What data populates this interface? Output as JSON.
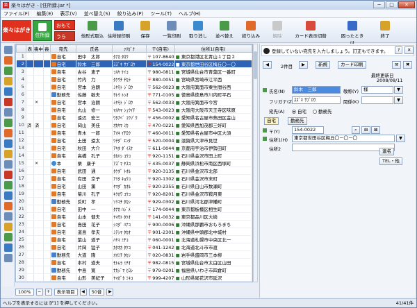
{
  "window": {
    "title": "楽々はがき - [住所録.jar *]",
    "app_icon": "楽",
    "min": "─",
    "max": "□",
    "close": "✕"
  },
  "menubar": [
    "ファイル(F)",
    "編集(E)",
    "表示(V)",
    "並べ替え(S)",
    "絞り込み(P)",
    "ツール(T)",
    "ヘルプ(H)"
  ],
  "toolbar": {
    "brand": "楽々はがき",
    "tab_address": "住所録",
    "tab_omote": "おもて",
    "tab_ura": "うら",
    "buttons": [
      {
        "label": "他形式取込",
        "icon": "import-icon",
        "color": "#4a9a4a",
        "disabled": false
      },
      {
        "label": "住所録印刷",
        "icon": "print-icon",
        "color": "#3a7ac2",
        "disabled": false
      },
      {
        "label": "保存",
        "icon": "save-icon",
        "color": "#d6a22a",
        "disabled": false
      },
      {
        "label": "一覧印刷",
        "icon": "list-print-icon",
        "color": "#6b8db8",
        "disabled": false
      },
      {
        "label": "取り消し",
        "icon": "undo-icon",
        "color": "#3a8ad0",
        "disabled": false
      },
      {
        "label": "並べ替え",
        "icon": "sort-icon",
        "color": "#4a9a4a",
        "disabled": false
      },
      {
        "label": "絞り込み",
        "icon": "filter-icon",
        "color": "#e06a2a",
        "disabled": false
      },
      {
        "label": "解除",
        "icon": "clear-filter-icon",
        "color": "#c9c9c9",
        "disabled": true
      },
      {
        "label": "カード表示切替",
        "icon": "card-toggle-icon",
        "color": "#d84a3a",
        "disabled": false
      },
      {
        "label": "困ったときは",
        "icon": "help-icon",
        "color": "#3a6ac8",
        "disabled": false
      },
      {
        "label": "終了",
        "icon": "exit-icon",
        "color": "#d6a22a",
        "disabled": false
      }
    ]
  },
  "grid": {
    "columns": [
      "",
      "表",
      "喪中",
      "喪",
      "宛先",
      "氏名",
      "ﾌﾘｶﾞﾅ",
      "〒(自宅)",
      "住所1(自宅)"
    ],
    "rows": [
      {
        "n": "1",
        "c1": "",
        "c2": "",
        "c3": "",
        "dest": "自宅",
        "type": "home",
        "name": "田中　太郎",
        "kana": "ﾀﾅｶ ﾀﾛｳ",
        "zip": "107-8640",
        "addr": "東京都港区北青山１丁目２"
      },
      {
        "n": "2",
        "c1": "",
        "c2": "",
        "c3": "",
        "dest": "自宅",
        "type": "home",
        "name": "鈴木　三郎",
        "kana": "ｽｽﾞｷ ｻﾌﾞﾛｳ",
        "zip": "154-0022",
        "addr": "東京都世田谷区梅丘〇－〇",
        "sel": true
      },
      {
        "n": "3",
        "c1": "",
        "c2": "",
        "c3": "",
        "dest": "自宅",
        "type": "home",
        "name": "古谷　恵子",
        "kana": "ﾌﾙﾔ ｹｲｺ",
        "zip": "980-0811",
        "addr": "宮城県仙台市青葉区一番町"
      },
      {
        "n": "4",
        "c1": "",
        "c2": "",
        "c3": "",
        "dest": "自宅",
        "type": "home",
        "name": "竹内　力",
        "kana": "ﾀｹｳﾁ ﾁｶﾗ",
        "zip": "880-0051",
        "addr": "宮崎県宮崎市江平西"
      },
      {
        "n": "5",
        "c1": "",
        "c2": "",
        "c3": "",
        "dest": "自宅",
        "type": "home",
        "name": "宮本　治朗",
        "kana": "ﾐﾔﾓﾄ ｼﾞﾛｳ",
        "zip": "562-0023",
        "addr": "大阪府箕面市粟生間谷西"
      },
      {
        "n": "6",
        "c1": "",
        "c2": "",
        "c3": "",
        "dest": "勤務先",
        "type": "work",
        "name": "佐藤　敏夫",
        "kana": "ｻﾄｳ ﾄｼｵ",
        "zip": "771-0105",
        "addr": "徳島県徳島市川内町平石"
      },
      {
        "n": "7",
        "c1": "",
        "c2": "×",
        "c3": "",
        "dest": "自宅",
        "type": "home",
        "name": "宮本　治朗",
        "kana": "ﾐﾔﾓﾄ ｼﾞﾛｳ",
        "zip": "562-0033",
        "addr": "大阪府箕面市今宮"
      },
      {
        "n": "8",
        "c1": "",
        "c2": "",
        "c3": "",
        "dest": "自宅",
        "type": "home",
        "name": "丸山　修一",
        "kana": "ﾏﾙﾔﾏ ｼｭｳｲﾁ",
        "zip": "543-0023",
        "addr": "大阪府大阪市天王寺区味原"
      },
      {
        "n": "9",
        "c1": "",
        "c2": "",
        "c3": "",
        "dest": "自宅",
        "type": "home",
        "name": "遠辺　宏三",
        "kana": "ﾜﾀﾅﾍﾞ ｺｳｿﾞｳ",
        "zip": "456-0002",
        "addr": "愛知県名古屋市熱田区金山"
      },
      {
        "n": "10",
        "c1": "済",
        "c2": "済",
        "c3": "",
        "dest": "自宅",
        "type": "home",
        "name": "岡山　美佳",
        "kana": "ｵｶﾔﾏ ﾐｶ",
        "zip": "470-0221",
        "addr": "愛知県西加茂郡三好町"
      },
      {
        "n": "11",
        "c1": "",
        "c2": "",
        "c3": "",
        "dest": "自宅",
        "type": "home",
        "name": "青木　一郎",
        "kana": "ｱｵｷ ｲﾁﾛｳ",
        "zip": "460-0011",
        "addr": "愛知県名古屋市中区大須"
      },
      {
        "n": "12",
        "c1": "",
        "c2": "",
        "c3": "",
        "dest": "自宅",
        "type": "home",
        "name": "土田　遠太",
        "kana": "ﾂﾁﾀﾞ ｴﾝﾀ",
        "zip": "520-0004",
        "addr": "滋賀県大津市見世"
      },
      {
        "n": "13",
        "c1": "",
        "c2": "",
        "c3": "",
        "dest": "自宅",
        "type": "home",
        "name": "秋田　大介",
        "kana": "ｱｷﾀ ﾀﾞｲｽｹ",
        "zip": "611-0044",
        "addr": "京都府宇治市伊勢田町"
      },
      {
        "n": "14",
        "c1": "",
        "c2": "",
        "c3": "",
        "dest": "自宅",
        "type": "home",
        "name": "高橋　孔子",
        "kana": "ﾀｶﾊｼ ｺｳｺ",
        "zip": "920-1151",
        "addr": "石川県金沢市田上町"
      },
      {
        "n": "15",
        "c1": "",
        "c2": "×",
        "c3": "",
        "dest": "本",
        "type": "per",
        "name": "栗　康子",
        "kana": "ｱｽﾞﾏ ﾔｽｺ",
        "zip": "435-0037",
        "addr": "静岡県浜松市南区西塚町"
      },
      {
        "n": "16",
        "c1": "",
        "c2": "",
        "c3": "",
        "dest": "自宅",
        "type": "home",
        "name": "武田　通",
        "kana": "ﾀｹﾀﾞ ﾄｵﾙ",
        "zip": "920-3135",
        "addr": "石川県金沢市北部"
      },
      {
        "n": "17",
        "c1": "",
        "c2": "",
        "c3": "",
        "dest": "自宅",
        "type": "home",
        "name": "有田　京子",
        "kana": "ｱﾘﾀ ｷｮｳｺ",
        "zip": "920-1302",
        "addr": "石川県金沢市末町"
      },
      {
        "n": "18",
        "c1": "",
        "c2": "",
        "c3": "",
        "dest": "自宅",
        "type": "home",
        "name": "山田　薫",
        "kana": "ﾔﾏﾀﾞ ｶｵﾙ",
        "zip": "920-2355",
        "addr": "石川県白山市数瀬町"
      },
      {
        "n": "19",
        "c1": "",
        "c2": "",
        "c3": "",
        "dest": "自宅",
        "type": "home",
        "name": "菊川　孔子",
        "kana": "ｷｸｶﾜ ｺｳｺ",
        "zip": "920-8201",
        "addr": "石川県金沢市鞍月東"
      },
      {
        "n": "20",
        "c1": "",
        "c2": "",
        "c3": "",
        "dest": "勤務先",
        "type": "work",
        "name": "反町　孝",
        "kana": "ｿﾘﾏﾁ ﾀｶｼ",
        "zip": "929-0302",
        "addr": "石川県河北郡津幡町"
      },
      {
        "n": "21",
        "c1": "",
        "c2": "",
        "c3": "",
        "dest": "自宅",
        "type": "home",
        "name": "田中　一",
        "kana": "ﾀﾅｶ ﾊｼﾞﾒ",
        "zip": "174-0044",
        "addr": "東京都板橋区相生町"
      },
      {
        "n": "22",
        "c1": "",
        "c2": "",
        "c3": "",
        "dest": "自宅",
        "type": "home",
        "name": "山本　健夫",
        "kana": "ﾔﾏﾓﾄ ﾀｹｵ",
        "zip": "141-0032",
        "addr": "東京都品川区大崎"
      },
      {
        "n": "23",
        "c1": "",
        "c2": "",
        "c3": "",
        "dest": "自宅",
        "type": "home",
        "name": "島田　花子",
        "kana": "ｼﾏﾀﾞ ﾊﾅｺ",
        "zip": "900-0006",
        "addr": "沖縄県那覇市おもろまち"
      },
      {
        "n": "24",
        "c1": "",
        "c2": "",
        "c3": "",
        "dest": "自宅",
        "type": "home",
        "name": "道島　孝夫",
        "kana": "ﾐﾁｼﾏ ﾀｶｵ",
        "zip": "901-2301",
        "addr": "沖縄県中頭郡北中城村"
      },
      {
        "n": "25",
        "c1": "",
        "c2": "",
        "c3": "",
        "dest": "自宅",
        "type": "home",
        "name": "葉山　道子",
        "kana": "ﾊﾔﾏ ﾐﾁｺ",
        "zip": "060-0001",
        "addr": "北海道札幌市中央区北一"
      },
      {
        "n": "26",
        "c1": "",
        "c2": "",
        "c3": "",
        "dest": "自宅",
        "type": "home",
        "name": "片岡　猛子",
        "kana": "ｶﾀｵｶ ﾀｹｺ",
        "zip": "041-1242",
        "addr": "北海道北斗市市渡"
      },
      {
        "n": "27",
        "c1": "",
        "c2": "",
        "c3": "",
        "dest": "勤務先",
        "type": "work",
        "name": "大道　隆",
        "kana": "ｵｵﾐﾁ ﾀｶｼ",
        "zip": "020-0831",
        "addr": "岩手県盛岡市三本柳"
      },
      {
        "n": "28",
        "c1": "",
        "c2": "",
        "c3": "",
        "dest": "自宅",
        "type": "home",
        "name": "本村　道夫",
        "kana": "ﾓﾄﾑﾗ ﾐﾁｵ",
        "zip": "982-0815",
        "addr": "宮城県仙台市太白区山田"
      },
      {
        "n": "29",
        "c1": "",
        "c2": "",
        "c3": "",
        "dest": "勤務先",
        "type": "work",
        "name": "中島　寛",
        "kana": "ﾅｶｼﾞﾏ ﾋﾛｼ",
        "zip": "979-0201",
        "addr": "福島県いわき市四倉町"
      },
      {
        "n": "30",
        "c1": "",
        "c2": "",
        "c3": "",
        "dest": "自宅",
        "type": "home",
        "name": "山形　美紀子",
        "kana": "ﾔﾏｶﾞﾀ ﾐｷｺ",
        "zip": "999-4207",
        "addr": "山形県尾花沢市延沢"
      },
      {
        "n": "31",
        "c1": "",
        "c2": "",
        "c3": "",
        "dest": "自宅",
        "type": "home",
        "name": "西川　かのこ",
        "kana": "ﾆｼｶﾜ ｶﾉｺ",
        "zip": "300-2601",
        "addr": "茨城県つくば市天久保"
      },
      {
        "n": "32",
        "c1": "",
        "c2": "",
        "c3": "",
        "dest": "自宅",
        "type": "home",
        "name": "宮原　恵子",
        "kana": "ﾐﾔﾊﾗ ｹｲｺ",
        "zip": "562-0023",
        "addr": "大阪府箕面市白島"
      },
      {
        "n": "33",
        "c1": "",
        "c2": "",
        "c3": "",
        "dest": "勤務先",
        "type": "work",
        "name": "吉田　裕",
        "kana": "ﾖｼﾀﾞ ﾕﾀｶ",
        "zip": "470-7037",
        "addr": "愛知県一宮市宮西通"
      }
    ]
  },
  "bottom_nav": {
    "zoom": "100%",
    "items_label": "表示項目",
    "count": "50音"
  },
  "panel": {
    "tip": "登録していない宛先を入力しましょう。訂正もできます。",
    "record_info": "2件目",
    "btn_new": "新規",
    "btn_card": "カード印刷",
    "updated_label": "最終更新日",
    "updated_value": "2008/08/11",
    "name_label": "氏名(N)",
    "name_value": "鈴木　三郎",
    "honorific_label": "敬称(Y)",
    "honorific_value": "様",
    "kana_label": "フリガナ(Z)",
    "kana_value": "ｽｽﾞｷ ｻﾌﾞﾛｳ",
    "relation_label": "関係(K)",
    "dest_label": "宛先(A)",
    "dest_home": "自宅",
    "dest_work": "勤務先",
    "tab_home": "自宅",
    "tab_work": "勤務先",
    "zip_label": "〒(Y)",
    "zip_value": "154-0022",
    "addr1_label": "住所1(H)",
    "addr1_value": "東京都世田谷区梅丘〇－〇－〇",
    "addr2_label": "住所2",
    "btn_joint": "連名",
    "btn_tel": "TEL・他"
  },
  "status": {
    "left": "ヘルプを表示するには [F1] を押してください。",
    "right": "41/41件"
  }
}
